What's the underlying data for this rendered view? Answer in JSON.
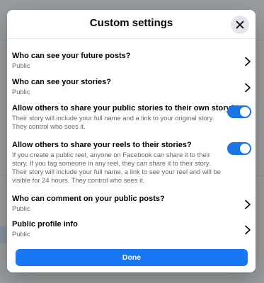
{
  "dialog": {
    "title": "Custom settings",
    "close_icon": "close-icon",
    "done_label": "Done",
    "accent": "#1877f2"
  },
  "settings": [
    {
      "title": "Who can see your future posts?",
      "subtitle": "Public",
      "control": "chevron"
    },
    {
      "title": "Who can see your stories?",
      "subtitle": "Public",
      "control": "chevron"
    },
    {
      "title": "Allow others to share your public stories to their own story?",
      "subtitle": "Their story will include your full name and a link to your original story. They control who sees it.",
      "control": "toggle",
      "enabled": true
    },
    {
      "title": "Allow others to share your reels to their stories?",
      "subtitle": "If you create a public reel, anyone on Facebook can share it to their story. If you tag someone in any reel, they can share it to their story. Their story will include your full name, a link to see your reel and will be visible for 24 hours. They control who sees it.",
      "control": "toggle",
      "enabled": true
    },
    {
      "title": "Who can comment on your public posts?",
      "subtitle": "Public",
      "control": "chevron"
    },
    {
      "title": "Public profile info",
      "subtitle": "Public",
      "control": "chevron"
    }
  ]
}
